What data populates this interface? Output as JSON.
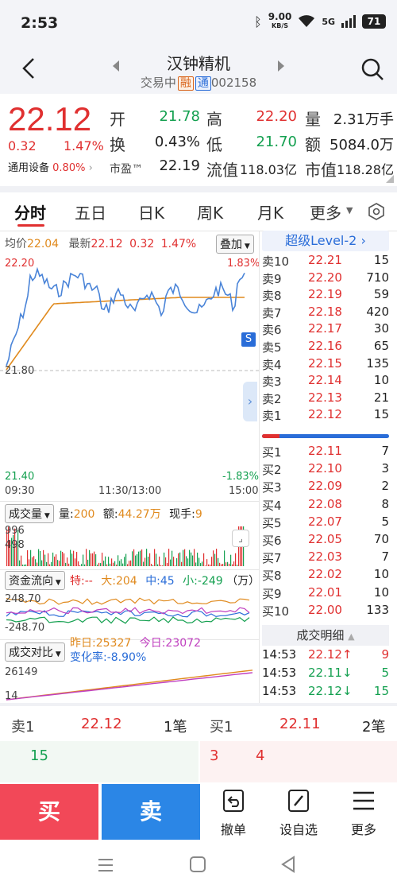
{
  "status": {
    "time": "2:53",
    "net_speed": "9.00",
    "net_unit": "KB/S",
    "signal": "5G",
    "battery": "71"
  },
  "header": {
    "name": "汉钟精机",
    "status_text": "交易中",
    "tag_rong": "融",
    "tag_tong": "通",
    "code": "002158"
  },
  "quote": {
    "price": "22.12",
    "change": "0.32",
    "change_pct": "1.47%",
    "labels": {
      "open": "开",
      "high": "高",
      "volume": "量",
      "turnover": "换",
      "low": "低",
      "amount": "额",
      "pe": "市盈™",
      "float_cap": "流值",
      "mkt_cap": "市值"
    },
    "open": "21.78",
    "high": "22.20",
    "volume": "2.31万手",
    "turnover_rate": "0.43%",
    "low": "21.70",
    "amount": "5084.0万",
    "industry": "通用设备",
    "industry_pct": "0.80%",
    "pe": "22.19",
    "float_cap": "118.03亿",
    "mkt_cap": "118.28亿"
  },
  "tabs": [
    "分时",
    "五日",
    "日K",
    "周K",
    "月K",
    "更多"
  ],
  "chart": {
    "avg_label": "均价",
    "avg_value": "22.04",
    "latest_label": "最新",
    "latest_value": "22.12",
    "latest_chg": "0.32",
    "latest_pct": "1.47%",
    "overlay_btn": "叠加",
    "y_top": "22.20",
    "y_mid": "21.80",
    "y_bot": "21.40",
    "pct_top": "1.83%",
    "pct_bot": "-1.83%",
    "x_labels": [
      "09:30",
      "11:30/13:00",
      "15:00"
    ],
    "s_marker": "S",
    "volume_btn": "成交量",
    "vol_label": "量:",
    "vol_value": "200",
    "amt_label": "额:",
    "amt_value": "44.27万",
    "now_label": "现手:",
    "now_value": "9",
    "vol_y_top": "996",
    "vol_y_mid": "498",
    "flow_btn": "资金流向",
    "flow_special": "特:--",
    "flow_big": "大:204",
    "flow_mid": "中:45",
    "flow_small": "小:-249",
    "flow_unit": "（万）",
    "flow_y_top": "248.70",
    "flow_y_bot": "-248.70",
    "compare_btn": "成交对比",
    "yesterday": "昨日:25327",
    "today": "今日:23072",
    "change_rate": "变化率:-8.90%",
    "cmp_y_top": "26149",
    "cmp_y_bot": "14"
  },
  "level2": {
    "title": "超级Level-2"
  },
  "asks": [
    {
      "label": "卖10",
      "price": "22.21",
      "vol": "15"
    },
    {
      "label": "卖9",
      "price": "22.20",
      "vol": "710"
    },
    {
      "label": "卖8",
      "price": "22.19",
      "vol": "59"
    },
    {
      "label": "卖7",
      "price": "22.18",
      "vol": "420"
    },
    {
      "label": "卖6",
      "price": "22.17",
      "vol": "30"
    },
    {
      "label": "卖5",
      "price": "22.16",
      "vol": "65"
    },
    {
      "label": "卖4",
      "price": "22.15",
      "vol": "135"
    },
    {
      "label": "卖3",
      "price": "22.14",
      "vol": "10"
    },
    {
      "label": "卖2",
      "price": "22.13",
      "vol": "21"
    },
    {
      "label": "卖1",
      "price": "22.12",
      "vol": "15"
    }
  ],
  "bids": [
    {
      "label": "买1",
      "price": "22.11",
      "vol": "7"
    },
    {
      "label": "买2",
      "price": "22.10",
      "vol": "3"
    },
    {
      "label": "买3",
      "price": "22.09",
      "vol": "2"
    },
    {
      "label": "买4",
      "price": "22.08",
      "vol": "8"
    },
    {
      "label": "买5",
      "price": "22.07",
      "vol": "5"
    },
    {
      "label": "买6",
      "price": "22.05",
      "vol": "70"
    },
    {
      "label": "买7",
      "price": "22.03",
      "vol": "7"
    },
    {
      "label": "买8",
      "price": "22.02",
      "vol": "10"
    },
    {
      "label": "买9",
      "price": "22.01",
      "vol": "10"
    },
    {
      "label": "买10",
      "price": "22.00",
      "vol": "133"
    }
  ],
  "trade_detail": {
    "title": "成交明细",
    "rows": [
      {
        "time": "14:53",
        "price": "22.12↑",
        "vol": "9"
      },
      {
        "time": "14:53",
        "price": "22.11↓",
        "vol": "5"
      },
      {
        "time": "14:53",
        "price": "22.12↓",
        "vol": "15"
      }
    ]
  },
  "quick": {
    "sell_label": "卖1",
    "sell_price": "22.12",
    "sell_count": "1笔",
    "sell_vol": "15",
    "buy_label": "买1",
    "buy_price": "22.11",
    "buy_count": "2笔",
    "buy_vol_a": "3",
    "buy_vol_b": "4"
  },
  "actions": {
    "buy": "买",
    "sell": "卖",
    "cancel": "撤单",
    "watchlist": "设自选",
    "more": "更多"
  },
  "colors": {
    "red": "#e03030",
    "green": "#14a050",
    "blue": "#2a6dd8",
    "buy_bg": "#f24858",
    "sell_bg": "#2b86e6"
  }
}
